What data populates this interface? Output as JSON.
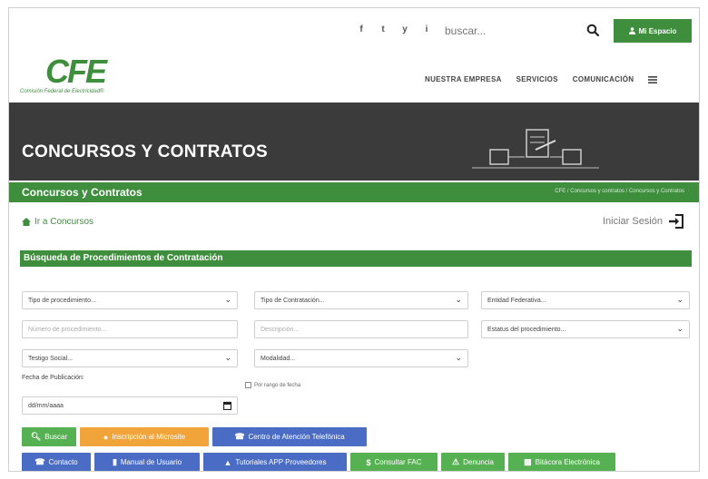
{
  "topbar": {
    "social_icons": [
      "f",
      "t",
      "y",
      "i"
    ],
    "search_placeholder": "buscar...",
    "my_space_label": "Mi Espacio"
  },
  "logo": {
    "mark": "CFE",
    "subtitle": "Comisión Federal de Electricidad®"
  },
  "nav": {
    "items": [
      "NUESTRA EMPRESA",
      "SERVICIOS",
      "COMUNICACIÓN"
    ]
  },
  "hero": {
    "title": "CONCURSOS Y CONTRATOS"
  },
  "section": {
    "title": "Concursos y Contratos",
    "breadcrumb": "CFE / Concursos y contratos / Concursos y Contratos"
  },
  "back_link": "Ir a Concursos",
  "login_link": "Iniciar Sesión",
  "form": {
    "title": "Búsqueda de Procedimientos de Contratación",
    "tipo_procedimiento": "Tipo de procedimiento...",
    "tipo_contratacion": "Tipo de Contratación...",
    "entidad": "Entidad Federativa...",
    "numero_placeholder": "Número de procedimiento...",
    "descripcion_placeholder": "Descripción...",
    "estatus": "Estatus del procedimiento...",
    "testigo": "Testigo Social...",
    "modalidad": "Modalidad...",
    "fecha_label": "Fecha de Publicación:",
    "fecha_value": "dd/mm/aaaa",
    "rango_label": "Por rango de fecha"
  },
  "buttons": {
    "buscar": "Buscar",
    "inscripcion": "Inscripción al Microsite",
    "centro": "Centro de Atención Telefónica",
    "contacto": "Contacto",
    "manual": "Manual de Usuario",
    "tutoriales": "Tutoriales APP Proveedores",
    "consultar": "Consultar FAC",
    "denuncia": "Denuncia",
    "bitacora": "Bitácora Electrónica"
  },
  "colors": {
    "brand_green": "#3e8e3e",
    "button_green": "#56b152",
    "button_orange": "#f1a43a",
    "button_blue": "#4a6cc4",
    "hero_dark": "#3b3b3b"
  }
}
